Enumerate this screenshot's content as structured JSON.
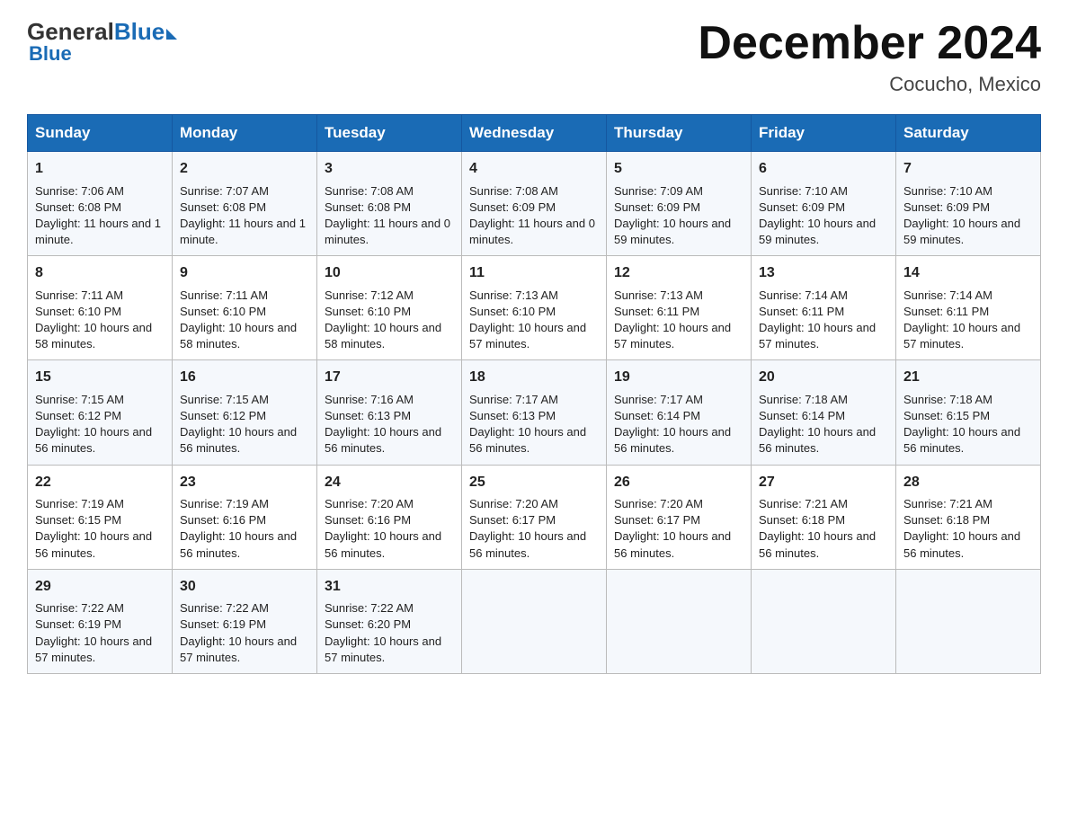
{
  "header": {
    "logo_general": "General",
    "logo_blue": "Blue",
    "month_title": "December 2024",
    "location": "Cocucho, Mexico"
  },
  "days_of_week": [
    "Sunday",
    "Monday",
    "Tuesday",
    "Wednesday",
    "Thursday",
    "Friday",
    "Saturday"
  ],
  "weeks": [
    [
      {
        "day": "1",
        "sunrise": "7:06 AM",
        "sunset": "6:08 PM",
        "daylight": "11 hours and 1 minute."
      },
      {
        "day": "2",
        "sunrise": "7:07 AM",
        "sunset": "6:08 PM",
        "daylight": "11 hours and 1 minute."
      },
      {
        "day": "3",
        "sunrise": "7:08 AM",
        "sunset": "6:08 PM",
        "daylight": "11 hours and 0 minutes."
      },
      {
        "day": "4",
        "sunrise": "7:08 AM",
        "sunset": "6:09 PM",
        "daylight": "11 hours and 0 minutes."
      },
      {
        "day": "5",
        "sunrise": "7:09 AM",
        "sunset": "6:09 PM",
        "daylight": "10 hours and 59 minutes."
      },
      {
        "day": "6",
        "sunrise": "7:10 AM",
        "sunset": "6:09 PM",
        "daylight": "10 hours and 59 minutes."
      },
      {
        "day": "7",
        "sunrise": "7:10 AM",
        "sunset": "6:09 PM",
        "daylight": "10 hours and 59 minutes."
      }
    ],
    [
      {
        "day": "8",
        "sunrise": "7:11 AM",
        "sunset": "6:10 PM",
        "daylight": "10 hours and 58 minutes."
      },
      {
        "day": "9",
        "sunrise": "7:11 AM",
        "sunset": "6:10 PM",
        "daylight": "10 hours and 58 minutes."
      },
      {
        "day": "10",
        "sunrise": "7:12 AM",
        "sunset": "6:10 PM",
        "daylight": "10 hours and 58 minutes."
      },
      {
        "day": "11",
        "sunrise": "7:13 AM",
        "sunset": "6:10 PM",
        "daylight": "10 hours and 57 minutes."
      },
      {
        "day": "12",
        "sunrise": "7:13 AM",
        "sunset": "6:11 PM",
        "daylight": "10 hours and 57 minutes."
      },
      {
        "day": "13",
        "sunrise": "7:14 AM",
        "sunset": "6:11 PM",
        "daylight": "10 hours and 57 minutes."
      },
      {
        "day": "14",
        "sunrise": "7:14 AM",
        "sunset": "6:11 PM",
        "daylight": "10 hours and 57 minutes."
      }
    ],
    [
      {
        "day": "15",
        "sunrise": "7:15 AM",
        "sunset": "6:12 PM",
        "daylight": "10 hours and 56 minutes."
      },
      {
        "day": "16",
        "sunrise": "7:15 AM",
        "sunset": "6:12 PM",
        "daylight": "10 hours and 56 minutes."
      },
      {
        "day": "17",
        "sunrise": "7:16 AM",
        "sunset": "6:13 PM",
        "daylight": "10 hours and 56 minutes."
      },
      {
        "day": "18",
        "sunrise": "7:17 AM",
        "sunset": "6:13 PM",
        "daylight": "10 hours and 56 minutes."
      },
      {
        "day": "19",
        "sunrise": "7:17 AM",
        "sunset": "6:14 PM",
        "daylight": "10 hours and 56 minutes."
      },
      {
        "day": "20",
        "sunrise": "7:18 AM",
        "sunset": "6:14 PM",
        "daylight": "10 hours and 56 minutes."
      },
      {
        "day": "21",
        "sunrise": "7:18 AM",
        "sunset": "6:15 PM",
        "daylight": "10 hours and 56 minutes."
      }
    ],
    [
      {
        "day": "22",
        "sunrise": "7:19 AM",
        "sunset": "6:15 PM",
        "daylight": "10 hours and 56 minutes."
      },
      {
        "day": "23",
        "sunrise": "7:19 AM",
        "sunset": "6:16 PM",
        "daylight": "10 hours and 56 minutes."
      },
      {
        "day": "24",
        "sunrise": "7:20 AM",
        "sunset": "6:16 PM",
        "daylight": "10 hours and 56 minutes."
      },
      {
        "day": "25",
        "sunrise": "7:20 AM",
        "sunset": "6:17 PM",
        "daylight": "10 hours and 56 minutes."
      },
      {
        "day": "26",
        "sunrise": "7:20 AM",
        "sunset": "6:17 PM",
        "daylight": "10 hours and 56 minutes."
      },
      {
        "day": "27",
        "sunrise": "7:21 AM",
        "sunset": "6:18 PM",
        "daylight": "10 hours and 56 minutes."
      },
      {
        "day": "28",
        "sunrise": "7:21 AM",
        "sunset": "6:18 PM",
        "daylight": "10 hours and 56 minutes."
      }
    ],
    [
      {
        "day": "29",
        "sunrise": "7:22 AM",
        "sunset": "6:19 PM",
        "daylight": "10 hours and 57 minutes."
      },
      {
        "day": "30",
        "sunrise": "7:22 AM",
        "sunset": "6:19 PM",
        "daylight": "10 hours and 57 minutes."
      },
      {
        "day": "31",
        "sunrise": "7:22 AM",
        "sunset": "6:20 PM",
        "daylight": "10 hours and 57 minutes."
      },
      null,
      null,
      null,
      null
    ]
  ],
  "labels": {
    "sunrise": "Sunrise:",
    "sunset": "Sunset:",
    "daylight": "Daylight:"
  }
}
